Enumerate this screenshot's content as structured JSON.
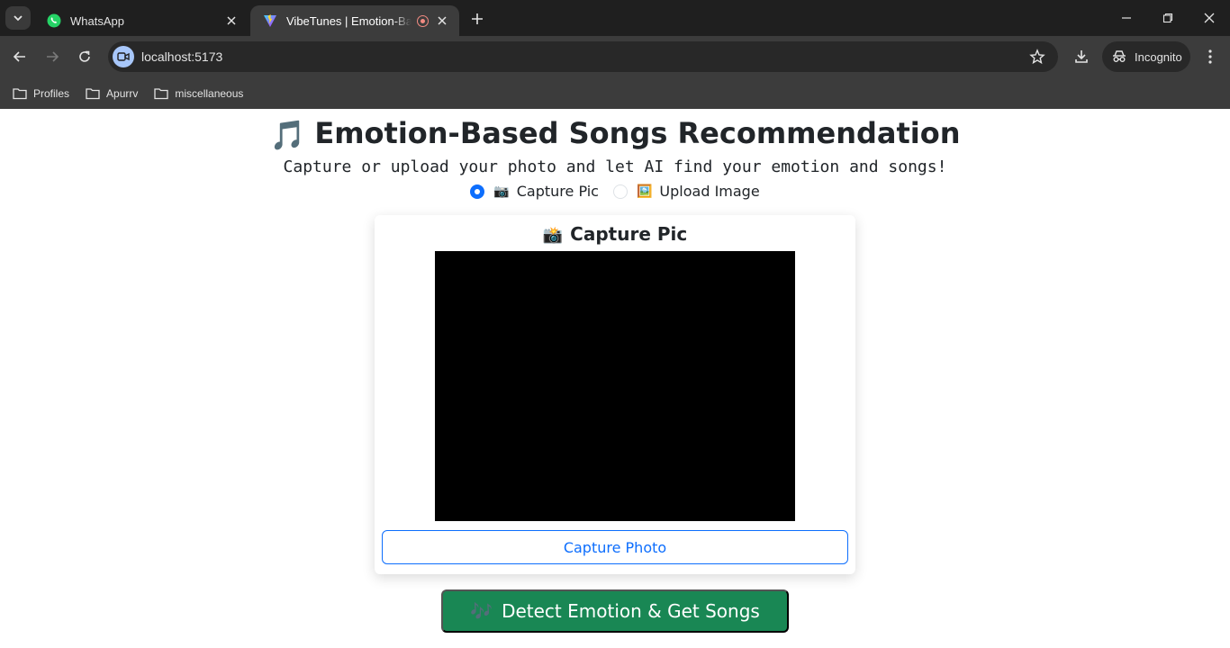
{
  "browser": {
    "tabs": [
      {
        "title": "WhatsApp",
        "active": false
      },
      {
        "title": "VibeTunes | Emotion-Based",
        "active": true
      }
    ],
    "url": "localhost:5173",
    "profile_label": "Incognito",
    "bookmarks": [
      {
        "label": "Profiles"
      },
      {
        "label": "Apurrv"
      },
      {
        "label": "miscellaneous"
      }
    ]
  },
  "page": {
    "title_emoji": "🎵",
    "title": "Emotion-Based Songs Recommendation",
    "subtitle": "Capture or upload your photo and let AI find your emotion and songs!",
    "modes": [
      {
        "emoji": "📷",
        "label": "Capture Pic",
        "selected": true
      },
      {
        "emoji": "🖼️",
        "label": "Upload Image",
        "selected": false
      }
    ],
    "card": {
      "emoji": "📸",
      "title": "Capture Pic",
      "capture_button": "Capture Photo"
    },
    "detect_button": {
      "emoji": "🎶",
      "label": "Detect Emotion & Get Songs"
    }
  },
  "colors": {
    "primary": "#0d6efd",
    "success": "#198754",
    "chrome_dark": "#1f1f1f",
    "chrome_toolbar": "#3c3c3c"
  }
}
